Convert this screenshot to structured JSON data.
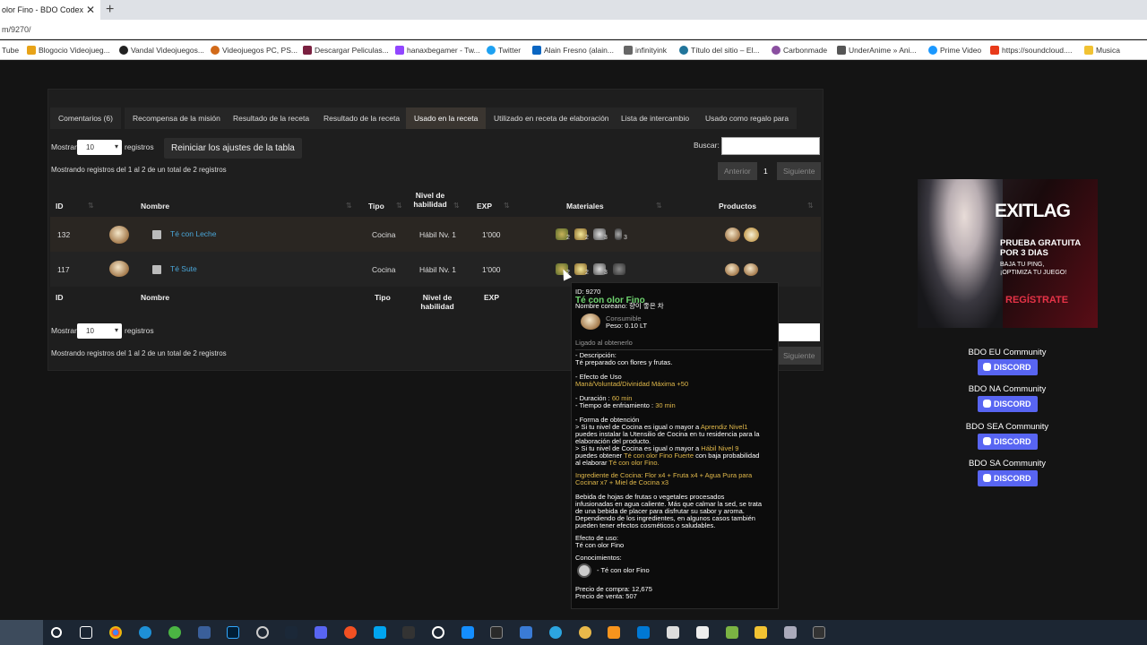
{
  "browser": {
    "tab_title": "olor Fino - BDO Codex",
    "tab_close": "✕",
    "new_tab": "+",
    "url": "m/9270/",
    "bookmarks": [
      "Tube",
      "Blogocio Videojueg...",
      "Vandal Videojuegos...",
      "Videojuegos PC, PS...",
      "Descargar Peliculas...",
      "hanaxbegamer - Tw...",
      "Twitter",
      "Alain Fresno (alain...",
      "infinityink",
      "Título del sitio – El...",
      "Carbonmade",
      "UnderAnime » Ani...",
      "Prime Video",
      "https://soundcloud....",
      "Musica"
    ]
  },
  "tabs": [
    "Comentarios (6)",
    "Recompensa de la misión",
    "Resultado de la receta",
    "Resultado de la receta",
    "Usado en la receta",
    "Utilizado en receta de elaboración",
    "Lista de intercambio",
    "Usado como regalo para"
  ],
  "controls": {
    "show_label": "Mostrar",
    "show_value": "10",
    "records_label": "registros",
    "reset_button": "Reiniciar los ajustes de la tabla",
    "search_label": "Buscar:",
    "search_value": "",
    "info": "Mostrando registros del 1 al 2 de un total de 2 registros",
    "prev": "Anterior",
    "page": "1",
    "next": "Siguiente"
  },
  "table": {
    "headers": {
      "id": "ID",
      "name": "Nombre",
      "type": "Tipo",
      "level_line1": "Nivel de",
      "level_line2": "habilidad",
      "exp": "EXP",
      "materials": "Materiales",
      "products": "Productos"
    },
    "rows": [
      {
        "id": "132",
        "name": "Té con Leche",
        "type": "Cocina",
        "level": "Hábil Nv. 1",
        "exp": "1'000",
        "mat_counts": [
          "2",
          "2",
          "3",
          "3"
        ]
      },
      {
        "id": "117",
        "name": "Té Sute",
        "type": "Cocina",
        "level": "Hábil Nv. 1",
        "exp": "1'000",
        "mat_counts": [
          "2",
          "2",
          "3"
        ]
      }
    ]
  },
  "tooltip": {
    "id": "ID: 9270",
    "name": "Té con olor Fino",
    "korean": "Nombre coreano: 향이 좋은 차",
    "category": "Consumible",
    "weight": "Peso: 0.10 LT",
    "bound": "Ligado al obtenerlo",
    "desc_label": "- Descripción:",
    "desc": "Té preparado con flores y frutas.",
    "effect_label": "- Efecto de Uso",
    "effect": "Maná/Voluntad/Divinidad Máxima +50",
    "duration_label": "- Duración : ",
    "duration": "60 min",
    "cooldown_label": "- Tiempo de enfriamiento : ",
    "cooldown": "30 min",
    "obtain_label": "- Forma de obtención",
    "obtain1a": "> Si tu nivel de Cocina es igual o mayor a ",
    "obtain1b": "Aprendiz Nivel1",
    "obtain1c": "puedes instalar la Utensilio de Cocina en tu residencia para la",
    "obtain1d": "elaboración del producto.",
    "obtain2a": "> Si tu nivel de Cocina es igual o mayor a ",
    "obtain2b": "Hábil Nivel 9",
    "obtain2c": "puedes obtener ",
    "obtain2d": "Té con olor Fino Fuerte",
    "obtain2e": " con baja probabilidad",
    "obtain2f": "al elaborar ",
    "obtain2g": "Té con olor Fino.",
    "ingredients1": "Ingrediente de Cocina: Flor x4 + Fruta x4 + Agua Pura para",
    "ingredients2": "Cocinar x7 + Miel de Cocina x3",
    "lore1": "Bebida de hojas de frutas o vegetales procesados",
    "lore2": "infusionadas en agua caliente. Más que calmar la sed, se trata",
    "lore3": "de una bebida de placer para disfrutar su sabor y aroma.",
    "lore4": "Dependiendo de los ingredientes, en algunos casos también",
    "lore5": "pueden tener efectos cosméticos o saludables.",
    "use_label": "Efecto de uso:",
    "use_value": "Té con olor Fino",
    "knowledge_label": "Conocimientos:",
    "knowledge_value": "- Té con olor Fino",
    "buy": "Precio de compra: 12,675",
    "sell": "Precio de venta: 507"
  },
  "ad": {
    "logo": "EXITLAG",
    "line1": "PRUEBA GRATUITA",
    "line2": "POR 3 DIAS",
    "small1": "BAJA TU PING,",
    "small2": "¡OPTIMIZA TU JUEGO!",
    "cta": "REGÍSTRATE"
  },
  "communities": [
    {
      "name": "BDO EU Community",
      "badge": "DISCORD"
    },
    {
      "name": "BDO NA Community",
      "badge": "DISCORD"
    },
    {
      "name": "BDO SEA Community",
      "badge": "DISCORD"
    },
    {
      "name": "BDO SA Community",
      "badge": "DISCORD"
    }
  ]
}
